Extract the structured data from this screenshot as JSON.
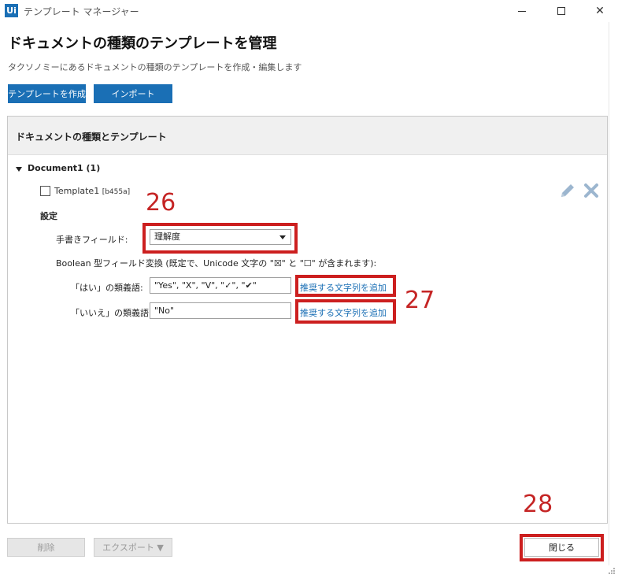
{
  "window": {
    "logo_text": "Ui",
    "title": "テンプレート マネージャー",
    "close_symbol": "✕"
  },
  "header": {
    "title": "ドキュメントの種類のテンプレートを管理",
    "subtitle": "タクソノミーにあるドキュメントの種類のテンプレートを作成・編集します"
  },
  "toolbar": {
    "create_label": "テンプレートを作成",
    "import_label": "インポート"
  },
  "panel": {
    "header": "ドキュメントの種類とテンプレート",
    "document": {
      "label": "Document1 (1)",
      "template_name": "Template1",
      "template_id": "[b455a]"
    },
    "settings": {
      "label": "設定",
      "handwriting_label": "手書きフィールド:",
      "handwriting_value": "理解度",
      "boolean_label": "Boolean 型フィールド変換 (既定で、Unicode 文字の \"☒\" と \"☐\" が含まれます):",
      "yes_label": "「はい」の類義語:",
      "yes_value": "\"Yes\", \"X\", \"V\", \"✓\", \"✔\"",
      "no_label": "「いいえ」の類義語:",
      "no_value": "\"No\"",
      "add_suggested_yes": "推奨する文字列を追加",
      "add_suggested_no": "推奨する文字列を追加"
    }
  },
  "annotations": {
    "num_26": "26",
    "num_27": "27",
    "num_28": "28",
    "color": "#cc1f1f"
  },
  "footer": {
    "delete_label": "削除",
    "export_label": "エクスポート ▼",
    "close_label": "閉じる"
  },
  "colors": {
    "accent": "#1a6fb5",
    "annotation": "#cc1f1f"
  }
}
